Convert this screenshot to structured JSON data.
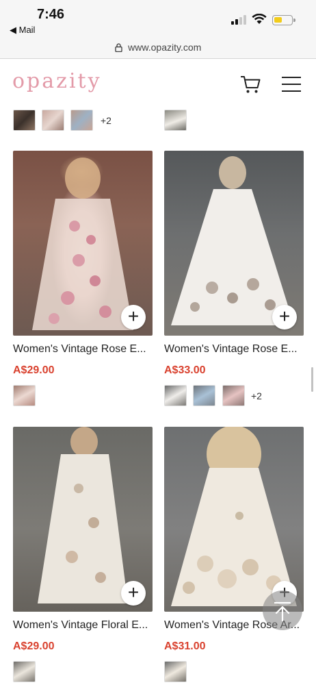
{
  "status_bar": {
    "time": "7:46",
    "back_app": "◀ Mail"
  },
  "browser": {
    "url": "www.opazity.com"
  },
  "header": {
    "logo": "opazity"
  },
  "colors": {
    "price": "#d9412e",
    "logo": "#e39aa8"
  },
  "icons": [
    "lock-icon",
    "cart-icon",
    "menu-icon",
    "plus-icon",
    "arrow-up-icon"
  ],
  "top_row": {
    "more_left": "+2"
  },
  "products": [
    {
      "title": "Women's Vintage Rose E...",
      "price": "A$29.00",
      "more": ""
    },
    {
      "title": "Women's Vintage Rose E...",
      "price": "A$33.00",
      "more": "+2"
    },
    {
      "title": "Women's Vintage Floral E...",
      "price": "A$29.00",
      "more": ""
    },
    {
      "title": "Women's Vintage Rose Ar...",
      "price": "A$31.00",
      "more": ""
    }
  ]
}
